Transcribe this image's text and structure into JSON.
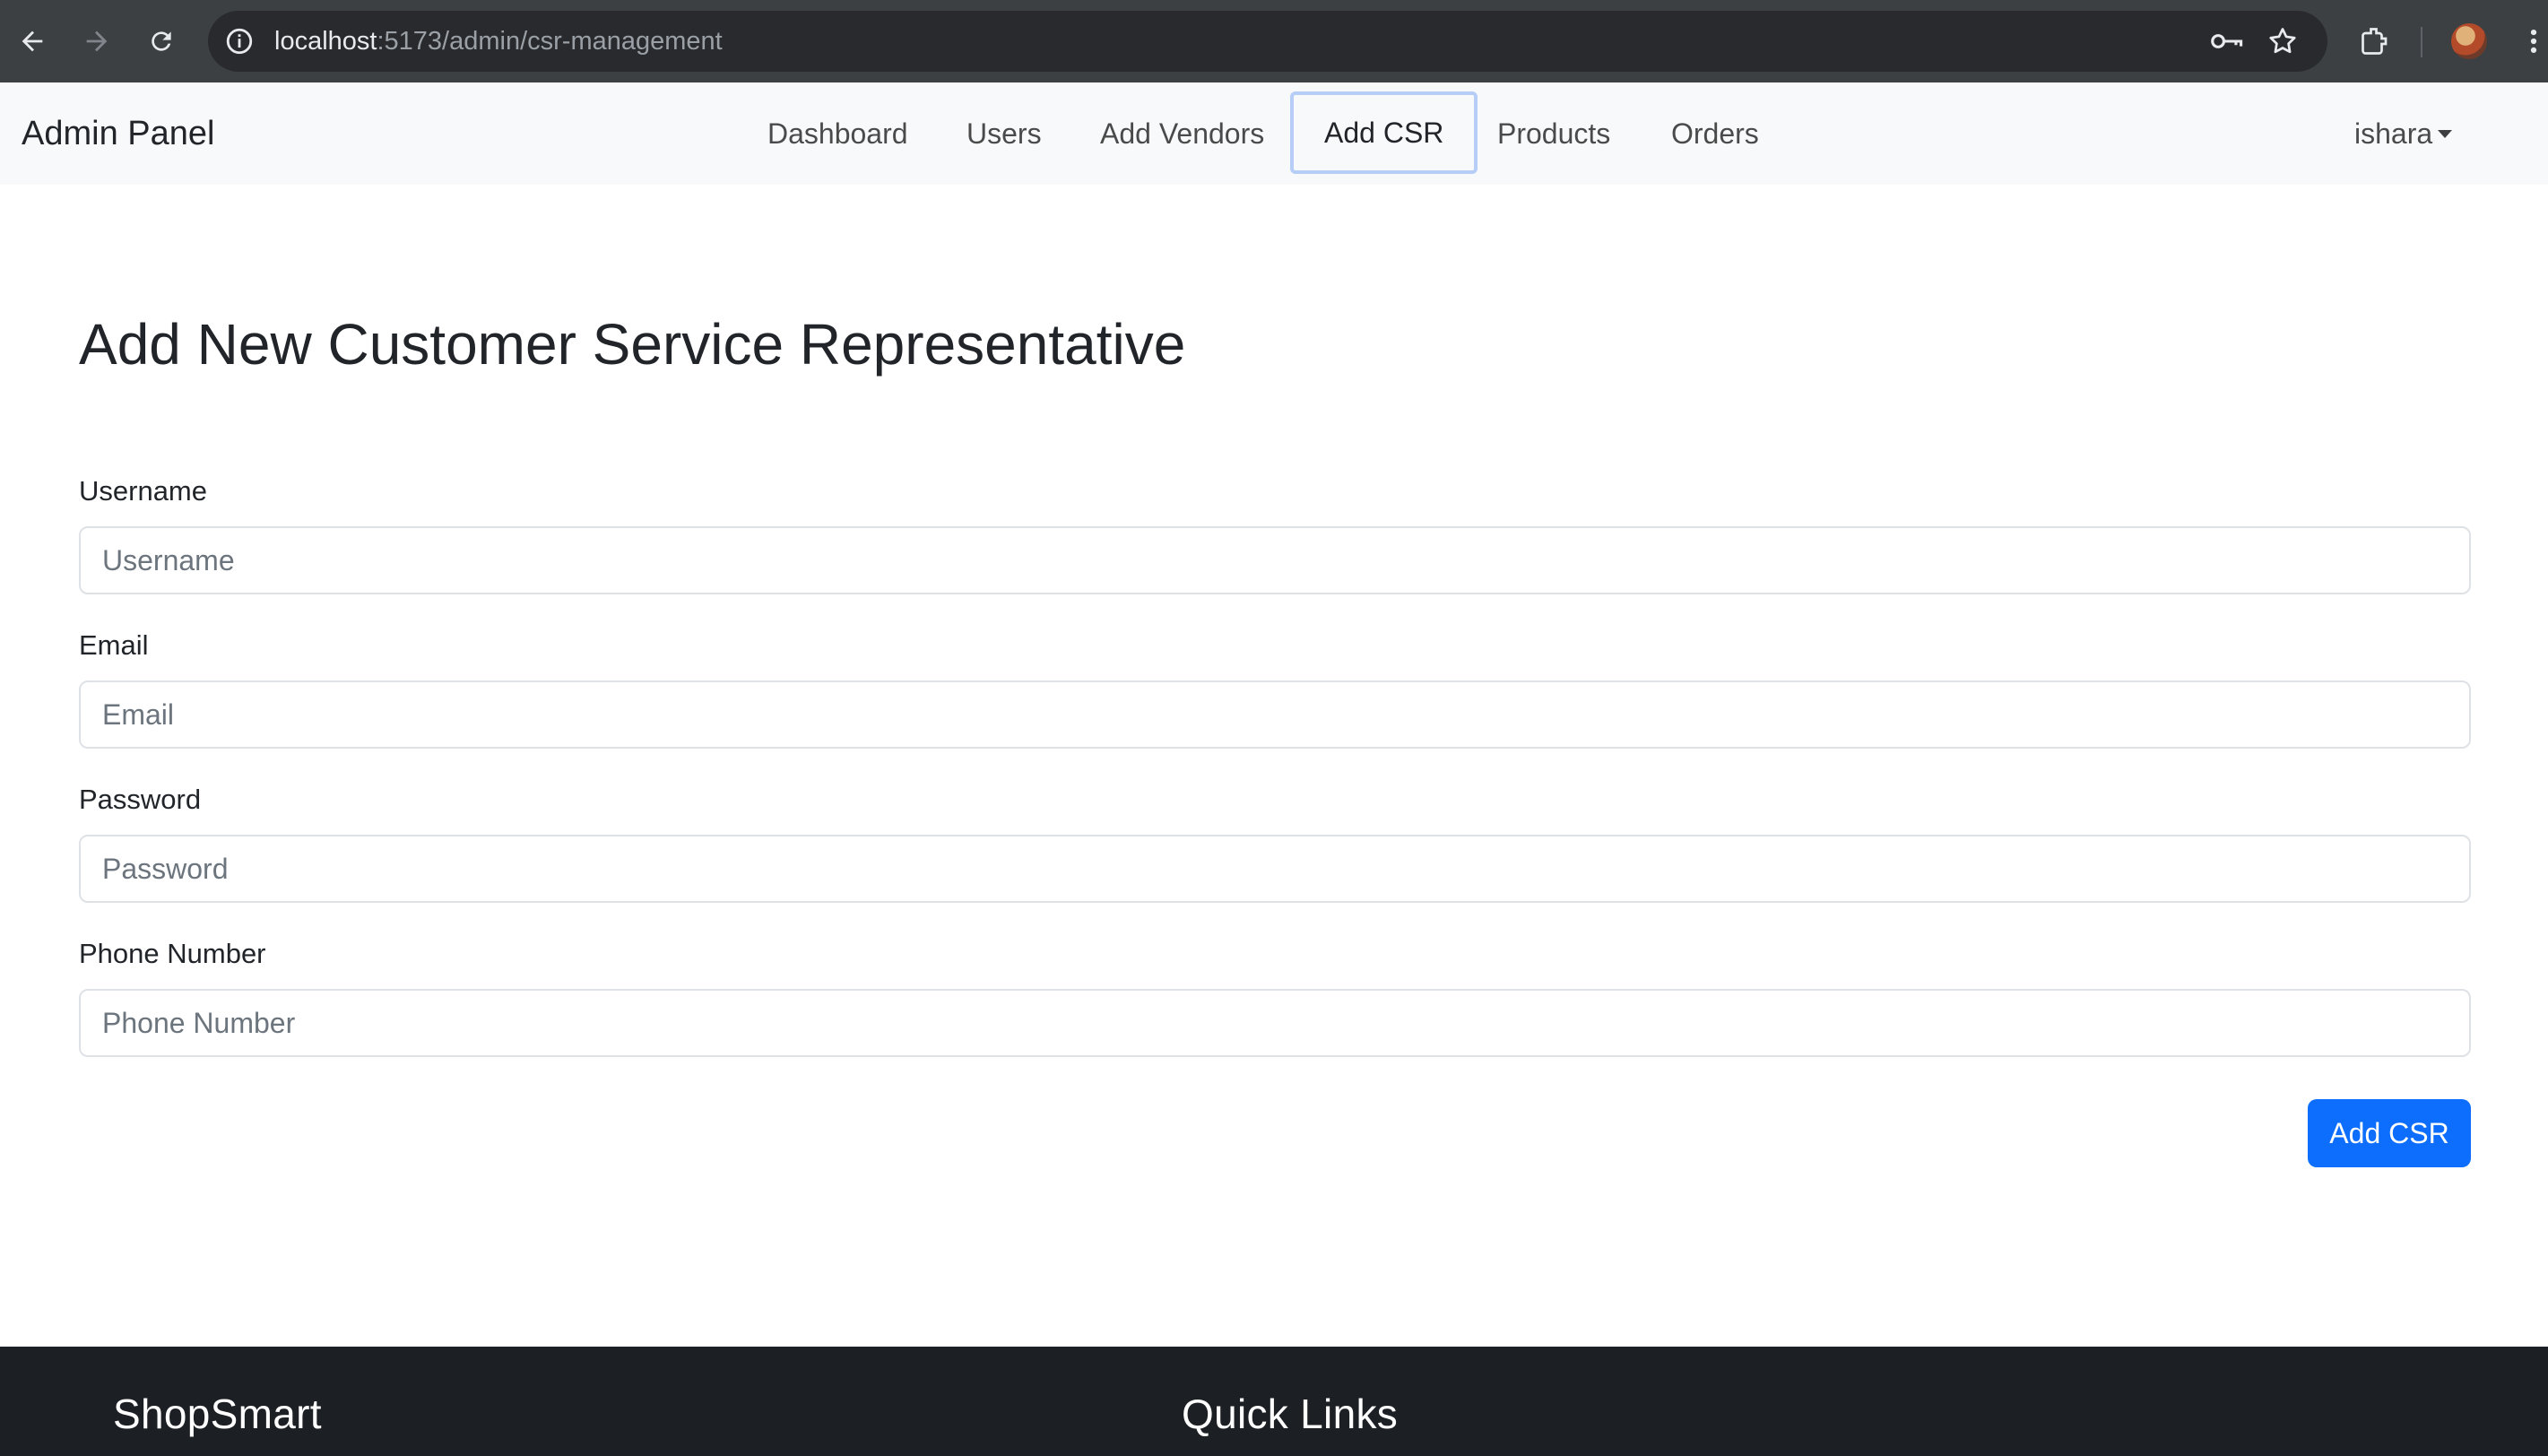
{
  "browser": {
    "url_host": "localhost",
    "url_path": ":5173/admin/csr-management"
  },
  "navbar": {
    "brand": "Admin Panel",
    "items": [
      {
        "label": "Dashboard"
      },
      {
        "label": "Users"
      },
      {
        "label": "Add Vendors"
      },
      {
        "label": "Add CSR",
        "active": true
      },
      {
        "label": "Products"
      },
      {
        "label": "Orders"
      }
    ],
    "user": "ishara"
  },
  "form": {
    "title": "Add New Customer Service Representative",
    "fields": [
      {
        "label": "Username",
        "placeholder": "Username",
        "value": ""
      },
      {
        "label": "Email",
        "placeholder": "Email",
        "value": ""
      },
      {
        "label": "Password",
        "placeholder": "Password",
        "value": ""
      },
      {
        "label": "Phone Number",
        "placeholder": "Phone Number",
        "value": ""
      }
    ],
    "submit_label": "Add CSR"
  },
  "footer": {
    "brand": "ShopSmart",
    "quick_links_heading": "Quick Links"
  },
  "colors": {
    "primary": "#0d6efd",
    "navbar_bg": "#f8f9fa",
    "footer_bg": "#1c1f23",
    "chrome_bg": "#3c4043"
  }
}
